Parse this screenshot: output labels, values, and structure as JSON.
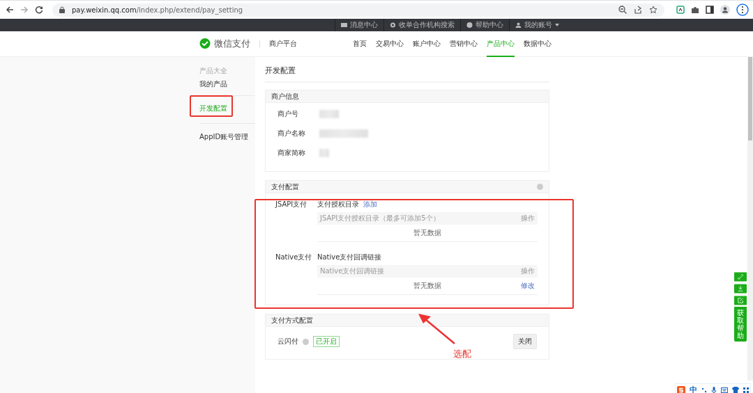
{
  "browser": {
    "url_host": "pay.weixin.qq.com",
    "url_path": "/index.php/extend/pay_setting"
  },
  "topbar": {
    "links": [
      {
        "label": "消息中心"
      },
      {
        "label": "收单合作机构搜索"
      },
      {
        "label": "帮助中心"
      },
      {
        "label": "我的账号"
      }
    ]
  },
  "header": {
    "logo": "微信支付",
    "subtitle": "商户平台",
    "nav": [
      {
        "label": "首页",
        "selected": false
      },
      {
        "label": "交易中心",
        "selected": false
      },
      {
        "label": "账户中心",
        "selected": false
      },
      {
        "label": "营销中心",
        "selected": false
      },
      {
        "label": "产品中心",
        "selected": true
      },
      {
        "label": "数据中心",
        "selected": false
      }
    ]
  },
  "sidebar": {
    "heading": "产品大全",
    "items": [
      {
        "label": "我的产品",
        "selected": false
      },
      {
        "label": "开发配置",
        "selected": true
      },
      {
        "label": "AppID账号管理",
        "selected": false
      }
    ]
  },
  "page_title": "开发配置",
  "merchant_info": {
    "title": "商户信息",
    "fields": [
      {
        "label": "商户号"
      },
      {
        "label": "商户名称"
      },
      {
        "label": "商家简称"
      }
    ]
  },
  "pay_config": {
    "title": "支付配置",
    "sections": [
      {
        "label": "JSAPI支付",
        "subtitle": "支付授权目录",
        "link": "添加",
        "column_1": "JSAPI支付授权目录（最多可添加5个）",
        "column_2": "操作",
        "empty": "暂无数据"
      },
      {
        "label": "Native支付",
        "subtitle": "Native支付回调链接",
        "column_1": "Native支付回调链接",
        "column_2": "操作",
        "empty": "暂无数据",
        "action": "修改"
      }
    ]
  },
  "pay_methods": {
    "title": "支付方式配置",
    "items": [
      {
        "label": "云闪付",
        "status": "已开启",
        "button": "关闭"
      }
    ]
  },
  "annotation": {
    "text": "选配"
  },
  "float_help": {
    "label": "获取帮助"
  },
  "ime": {
    "label": "中"
  }
}
